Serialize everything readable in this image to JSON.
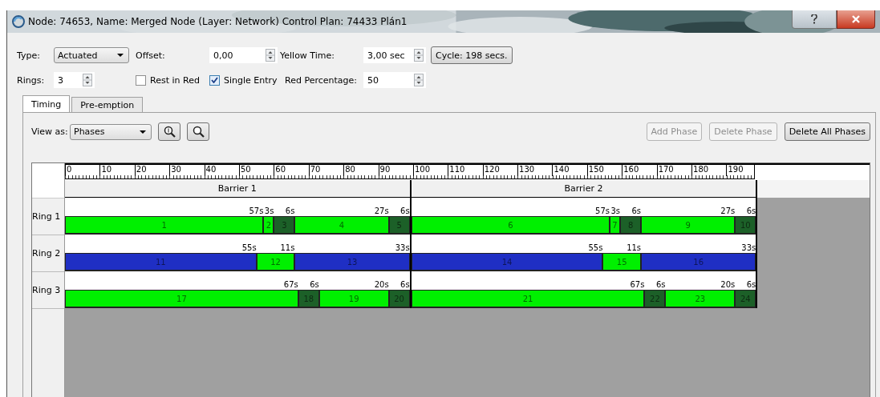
{
  "window": {
    "title": "Node: 74653, Name: Merged Node (Layer: Network) Control Plan: 74433 Plán1"
  },
  "settings": {
    "type": {
      "label": "Type:",
      "value": "Actuated"
    },
    "offset": {
      "label": "Offset:",
      "value": "0,00"
    },
    "yellow_time": {
      "label": "Yellow Time:",
      "value": "3,00 sec"
    },
    "cycle_button": "Cycle: 198 secs.",
    "rings": {
      "label": "Rings:",
      "value": "3"
    },
    "rest_in_red": {
      "label": "Rest in Red",
      "checked": false
    },
    "single_entry": {
      "label": "Single Entry",
      "checked": true
    },
    "red_percentage": {
      "label": "Red Percentage:",
      "value": "50"
    }
  },
  "tabs": [
    {
      "label": "Timing",
      "selected": true
    },
    {
      "label": "Pre-emption",
      "selected": false
    }
  ],
  "toolbar": {
    "view_as": {
      "label": "View as:",
      "value": "Phases"
    },
    "buttons": [
      {
        "label": "Add Phase",
        "disabled": true
      },
      {
        "label": "Delete Phase",
        "disabled": true
      },
      {
        "label": "Delete All Phases",
        "disabled": false
      }
    ]
  },
  "diagram": {
    "ticks": [
      "0",
      "10",
      "20",
      "30",
      "40",
      "50",
      "60",
      "70",
      "80",
      "90",
      "100",
      "110",
      "120",
      "130",
      "140",
      "150",
      "160",
      "170",
      "180",
      "190"
    ],
    "ring_labels": [
      "Ring 1",
      "Ring 2",
      "Ring 3"
    ],
    "barriers": [
      {
        "label": "Barrier 1",
        "rings": [
          [
            {
              "number": "1",
              "duration": "57s",
              "color": "#00f000"
            },
            {
              "number": "2",
              "duration": "3s",
              "color": "#00f000"
            },
            {
              "number": "3",
              "duration": "6s",
              "color": "#1c6028"
            },
            {
              "number": "4",
              "duration": "27s",
              "color": "#00f000"
            },
            {
              "number": "5",
              "duration": "6s",
              "color": "#1c6028"
            }
          ],
          [
            {
              "number": "11",
              "duration": "55s",
              "color": "#1f2fc4"
            },
            {
              "number": "12",
              "duration": "11s",
              "color": "#00f000"
            },
            {
              "number": "13",
              "duration": "33s",
              "color": "#1f2fc4"
            }
          ],
          [
            {
              "number": "17",
              "duration": "67s",
              "color": "#00f000"
            },
            {
              "number": "18",
              "duration": "6s",
              "color": "#1c6028"
            },
            {
              "number": "19",
              "duration": "20s",
              "color": "#00f000"
            },
            {
              "number": "20",
              "duration": "6s",
              "color": "#1c6028"
            }
          ]
        ]
      },
      {
        "label": "Barrier 2",
        "rings": [
          [
            {
              "number": "6",
              "duration": "57s",
              "color": "#00f000"
            },
            {
              "number": "7",
              "duration": "3s",
              "color": "#00f000"
            },
            {
              "number": "8",
              "duration": "6s",
              "color": "#1c6028"
            },
            {
              "number": "9",
              "duration": "27s",
              "color": "#00f000"
            },
            {
              "number": "10",
              "duration": "6s",
              "color": "#1c6028"
            }
          ],
          [
            {
              "number": "14",
              "duration": "55s",
              "color": "#1f2fc4"
            },
            {
              "number": "15",
              "duration": "11s",
              "color": "#00f000"
            },
            {
              "number": "16",
              "duration": "33s",
              "color": "#1f2fc4"
            }
          ],
          [
            {
              "number": "21",
              "duration": "67s",
              "color": "#00f000"
            },
            {
              "number": "22",
              "duration": "6s",
              "color": "#1c6028"
            },
            {
              "number": "23",
              "duration": "20s",
              "color": "#00f000"
            },
            {
              "number": "24",
              "duration": "6s",
              "color": "#1c6028"
            }
          ]
        ]
      }
    ]
  }
}
